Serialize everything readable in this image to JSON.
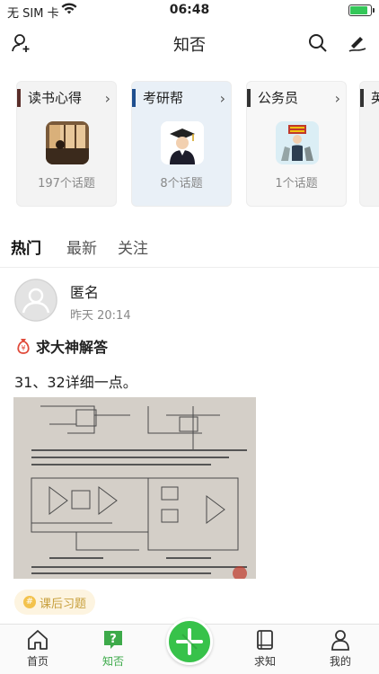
{
  "status_bar": {
    "carrier": "无 SIM 卡",
    "time": "06:48",
    "battery_level": 0.85
  },
  "navbar": {
    "title": "知否"
  },
  "topic_cards": [
    {
      "title": "读书心得",
      "count": "197个话题"
    },
    {
      "title": "考研帮",
      "count": "8个话题"
    },
    {
      "title": "公务员",
      "count": "1个话题"
    },
    {
      "title": "英"
    }
  ],
  "tabs": [
    {
      "label": "热门"
    },
    {
      "label": "最新"
    },
    {
      "label": "关注"
    }
  ],
  "post": {
    "user": "匿名",
    "time": "昨天 20:14",
    "bounty_label": "求大神解答",
    "text": "31、32详细一点。",
    "tag": "课后习题"
  },
  "tabbar": [
    {
      "label": "首页"
    },
    {
      "label": "知否"
    },
    {
      "label": "求知"
    },
    {
      "label": "我的"
    }
  ],
  "colors": {
    "accent": "#3daa4a",
    "fab": "#37c24a",
    "tag_bg": "#fdf4e0",
    "tag_text": "#c79f3c"
  }
}
